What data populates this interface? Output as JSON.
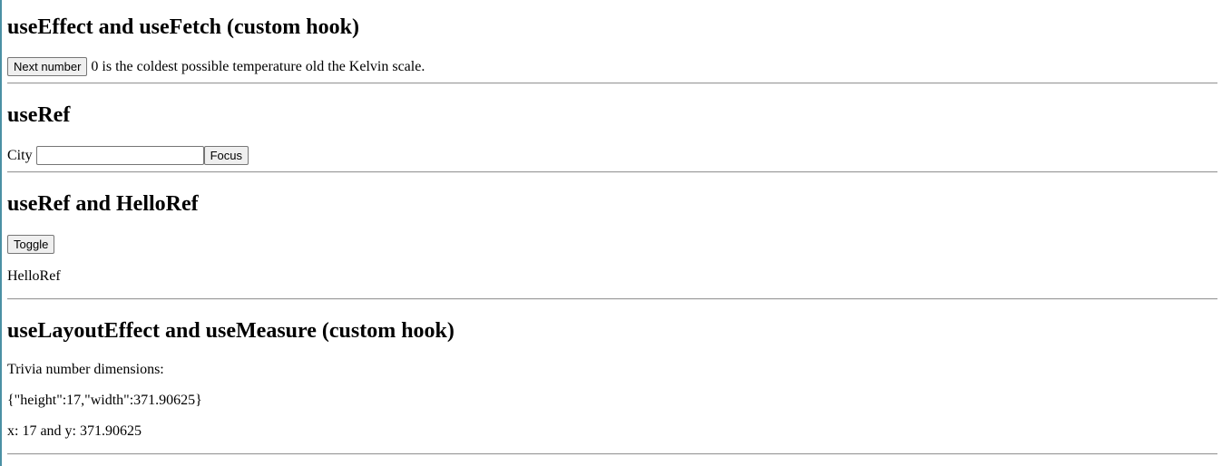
{
  "sections": {
    "fetch": {
      "heading": "useEffect and useFetch (custom hook)",
      "next_button": "Next number",
      "trivia": "0 is the coldest possible temperature old the Kelvin scale."
    },
    "ref": {
      "heading": "useRef",
      "city_label": "City",
      "city_value": "",
      "focus_button": "Focus"
    },
    "hello_ref": {
      "heading": "useRef and HelloRef",
      "toggle_button": "Toggle",
      "hello_text": "HelloRef"
    },
    "measure": {
      "heading": "useLayoutEffect and useMeasure (custom hook)",
      "dimensions_label": "Trivia number dimensions:",
      "dimensions_json": "{\"height\":17,\"width\":371.90625}",
      "coords": "x: 17 and y: 371.90625"
    }
  }
}
